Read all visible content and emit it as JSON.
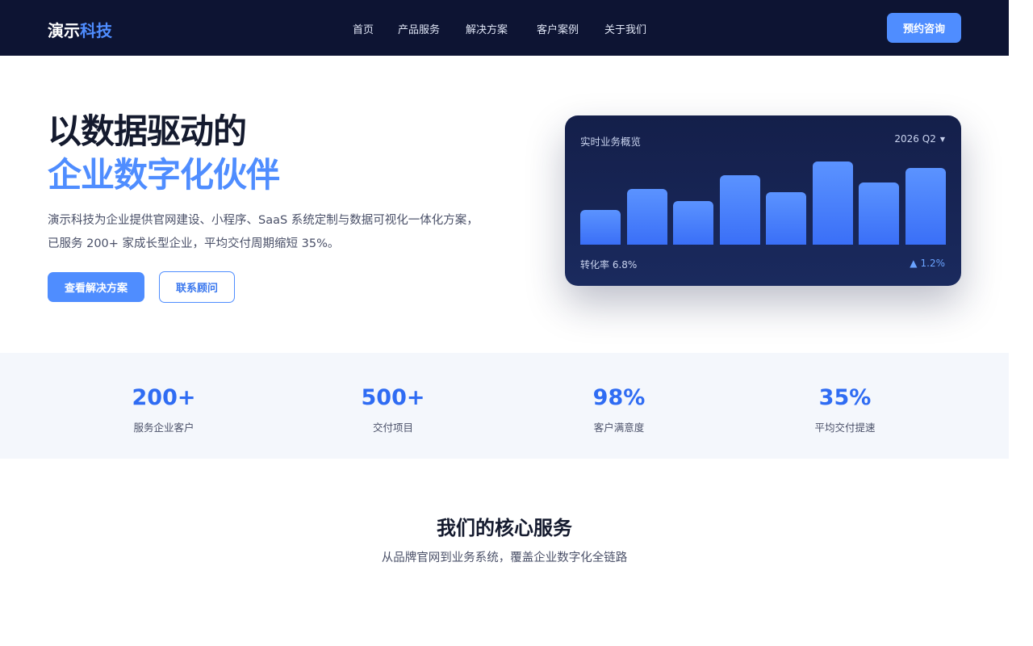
{
  "nav": {
    "logo_main": "演示",
    "logo_accent": "科技",
    "links": [
      "首页",
      "产品服务",
      "解决方案",
      "客户案例",
      "关于我们"
    ],
    "cta": "预约咨询"
  },
  "hero": {
    "title_line1": "以数据驱动的",
    "title_line2": "企业数字化伙伴",
    "desc_line1": "演示科技为企业提供官网建设、小程序、SaaS 系统定制与数据可视化一体化方案，",
    "desc_line2": "已服务 200+ 家成长型企业，平均交付周期缩短 35%。",
    "primary_button": "查看解决方案",
    "secondary_button": "联系顾问"
  },
  "card": {
    "title": "实时业务概览",
    "period": "2026 Q2",
    "metric": "转化率 6.8%",
    "change": "1.2%",
    "bar_values": [
      0.38,
      0.62,
      0.48,
      0.77,
      0.58,
      0.92,
      0.69,
      0.85
    ]
  },
  "stats": [
    {
      "value": "200+",
      "label": "服务企业客户"
    },
    {
      "value": "500+",
      "label": "交付项目"
    },
    {
      "value": "98%",
      "label": "客户满意度"
    },
    {
      "value": "35%",
      "label": "平均交付提速"
    }
  ],
  "services": {
    "title": "我们的核心服务",
    "subtitle": "从品牌官网到业务系统，覆盖企业数字化全链路"
  },
  "colors": {
    "accent": "#4f8dff",
    "nav_bg": "#0d1433",
    "stat_value": "#2f6cf3"
  }
}
